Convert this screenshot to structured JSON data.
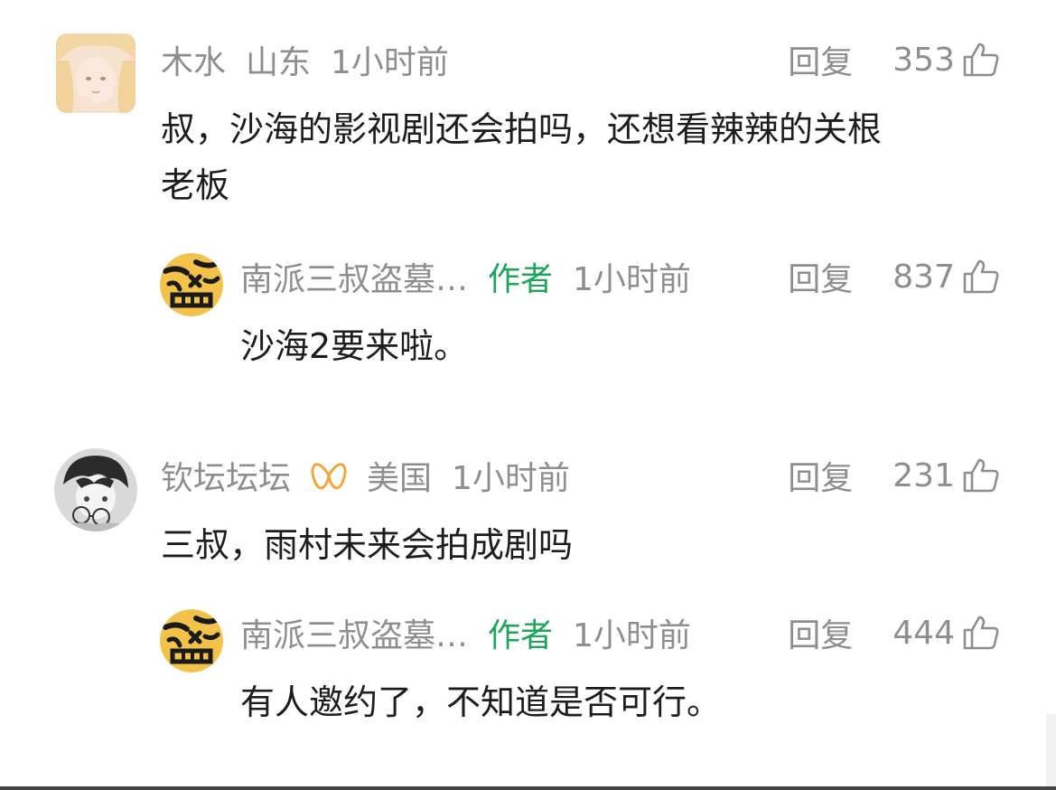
{
  "comments": [
    {
      "user": "木水",
      "location": "山东",
      "time": "1小时前",
      "reply_label": "回复",
      "likes": "353",
      "text_lines": [
        "叔，沙海的影视剧还会拍吗，还想看辣辣的关根",
        "老板"
      ],
      "avatar_icon": "anime-girl-avatar",
      "reply": {
        "user": "南派三叔盗墓…",
        "badge": "作者",
        "time": "1小时前",
        "reply_label": "回复",
        "likes": "837",
        "text": "沙海2要来啦。",
        "avatar_icon": "tiger-seal-avatar"
      }
    },
    {
      "user": "钦坛坛坛",
      "vip_icon": "vip-ribbon-icon",
      "location": "美国",
      "time": "1小时前",
      "reply_label": "回复",
      "likes": "231",
      "text_lines": [
        "三叔，雨村未来会拍成剧吗"
      ],
      "avatar_icon": "anime-boy-glasses-avatar",
      "reply": {
        "user": "南派三叔盗墓…",
        "badge": "作者",
        "time": "1小时前",
        "reply_label": "回复",
        "likes": "444",
        "text": "有人邀约了，不知道是否可行。",
        "avatar_icon": "tiger-seal-avatar"
      }
    }
  ],
  "colors": {
    "author_badge": "#1ea55c",
    "meta_gray": "#8e8e8e",
    "vip_orange": "#f0a63a"
  }
}
